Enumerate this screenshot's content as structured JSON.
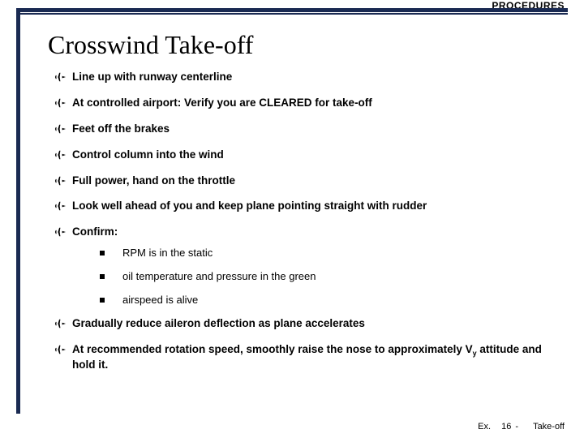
{
  "header": {
    "label": "PROCEDURES"
  },
  "title": "Crosswind Take-off",
  "bullets": {
    "b0": "Line up with runway centerline",
    "b1": "At controlled airport: Verify you are CLEARED for take-off",
    "b2": "Feet off the brakes",
    "b3": "Control column into the wind",
    "b4": "Full power, hand on the throttle",
    "b5": "Look well ahead of you and keep plane pointing straight with rudder",
    "b6": "Confirm:",
    "b7": "Gradually reduce aileron deflection as plane accelerates",
    "b8_pre": "At recommended rotation speed, smoothly raise the nose to approximately V",
    "b8_sub": "y",
    "b8_post": " attitude and hold it."
  },
  "subs": {
    "s0": "RPM is in the static",
    "s1": "oil temperature and pressure in the green",
    "s2": "airspeed is alive"
  },
  "footer": {
    "ex": "Ex.",
    "num": "16",
    "dash": "-",
    "topic": "Take-off"
  }
}
